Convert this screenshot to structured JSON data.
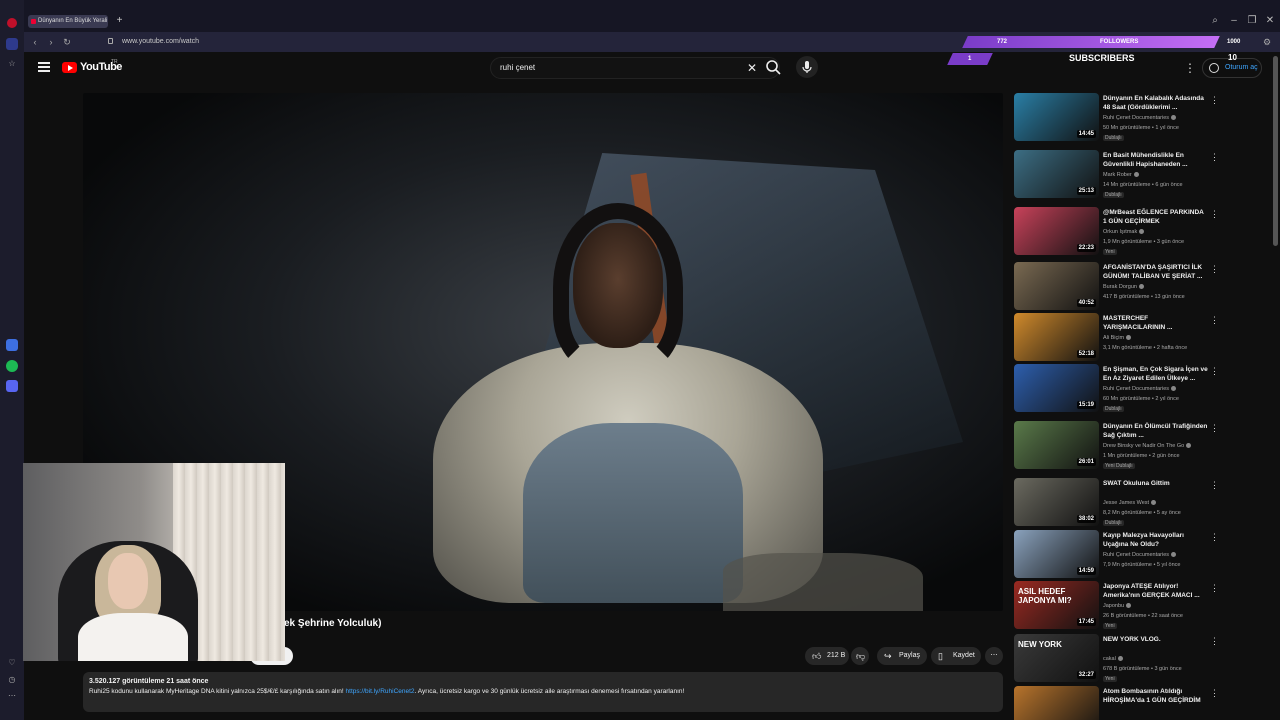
{
  "browser": {
    "tab_title": "Dünyanın En Büyük Yerali",
    "new_tab": "+",
    "url": "www.youtube.com/watch",
    "window": {
      "search": "⌕",
      "minimize": "–",
      "restore": "❐",
      "close": "✕"
    }
  },
  "youtube": {
    "logo_text": "YouTube",
    "region": "TR",
    "search_value": "ruhi çenet",
    "clear": "✕",
    "menu": "⋮",
    "sign_in": "Oturum aç"
  },
  "overlay": {
    "followers_count": "772",
    "followers_label": "FOLLOWERS",
    "followers_goal": "1000",
    "subscribers_count": "1",
    "subscribers_label": "SUBSCRIBERS",
    "subscribers_goal": "10"
  },
  "video": {
    "title_fragment": "ek Şehrine Yolculuk)",
    "likes": "212 B",
    "share": "Paylaş",
    "save": "Kaydet",
    "more": "⋯",
    "views_line": "3.520.127 görüntüleme  21 saat önce",
    "description_text": "Ruhi25 kodunu kullanarak MyHeritage DNA kitini yalnızca 25$/€/£ karşılığında satın alın! ",
    "description_link": "https://bit.ly/RuhiCenet2",
    "description_tail": ". Ayrıca, ücretsiz kargo ve 30 günlük ücretsiz aile araştırması denemesi fırsatından yararlanın!"
  },
  "recommendations": [
    {
      "title": "Dünyanın En Kalabalık Adasında 48 Saat (Gördüklerimi ...",
      "channel": "Ruhi Çenet Documentaries",
      "meta": "50 Mn görüntüleme • 1 yıl önce",
      "badge": "Dublajlı",
      "duration": "14:45",
      "thumb_color": "#2a7fa6"
    },
    {
      "title": "En Basit Mühendislikle En Güvenlikli Hapishaneden ...",
      "channel": "Mark Rober",
      "meta": "14 Mn görüntüleme • 6 gün önce",
      "badge": "Dublajlı",
      "duration": "25:13",
      "thumb_color": "#3c6e84"
    },
    {
      "title": "@MrBeast  EĞLENCE PARKINDA 1 GÜN GEÇİRMEK",
      "channel": "Orkun Işıtmak",
      "meta": "1,9 Mn görüntüleme • 3 gün önce",
      "badge": "Yeni",
      "duration": "22:23",
      "thumb_color": "#c8425a"
    },
    {
      "title": "AFGANİSTAN'DA ŞAŞIRTICI İLK GÜNÜM! TALİBAN VE ŞERİAT ...",
      "channel": "Burak Dorgun",
      "meta": "417 B görüntüleme • 13 gün önce",
      "badge": "",
      "duration": "40:52",
      "thumb_color": "#7a6a52"
    },
    {
      "title": "MASTERCHEF YARIŞMACILARININ ...",
      "channel": "Ali Biçim",
      "meta": "3,1 Mn görüntüleme • 2 hafta önce",
      "badge": "",
      "duration": "52:18",
      "thumb_color": "#d08a2c"
    },
    {
      "title": "En Şişman, En Çok Sigara İçen ve En Az Ziyaret Edilen Ülkeye ...",
      "channel": "Ruhi Çenet Documentaries",
      "meta": "60 Mn görüntüleme • 2 yıl önce",
      "badge": "Dublajlı",
      "duration": "15:19",
      "thumb_color": "#2d5fae"
    },
    {
      "title": "Dünyanın En Ölümcül Trafiğinden Sağ Çıktım ...",
      "channel": "Drew Binsky  ve Nadir On The Go",
      "meta": "1 Mn görüntüleme • 2 gün önce",
      "badge": "Yeni  Dublajlı",
      "duration": "26:01",
      "thumb_color": "#5a7a4a"
    },
    {
      "title": "SWAT Okuluna Gittim",
      "channel": "Jesse James West",
      "meta": "8,2 Mn görüntüleme • 5 ay önce",
      "badge": "Dublajlı",
      "duration": "38:02",
      "thumb_color": "#6b6a60"
    },
    {
      "title": "Kayıp Malezya Havayolları Uçağına Ne Oldu?",
      "channel": "Ruhi Çenet Documentaries",
      "meta": "7,9 Mn görüntüleme • 5 yıl önce",
      "badge": "",
      "duration": "14:59",
      "thumb_color": "#8aa2bd"
    },
    {
      "title": "Japonya ATEŞE Atılıyor! Amerika'nın GERÇEK AMACI ...",
      "channel": "Japonbu",
      "meta": "26 B görüntüleme • 22 saat önce",
      "badge": "Yeni",
      "duration": "17:45",
      "thumb_color": "#9a2a22",
      "thumb_text": "ASIL HEDEF JAPONYA MI?"
    },
    {
      "title": "NEW YORK VLOG.",
      "channel": "cakal",
      "meta": "678 B görüntüleme • 3 gün önce",
      "badge": "Yeni",
      "duration": "32:27",
      "thumb_color": "#3a3a3a",
      "thumb_text": "NEW YORK"
    },
    {
      "title": "Atom Bombasının Atıldığı HİROŞİMA'da 1 GÜN GEÇİRDİM (...",
      "channel": "",
      "meta": "",
      "badge": "",
      "duration": "",
      "thumb_color": "#b8742c"
    }
  ]
}
